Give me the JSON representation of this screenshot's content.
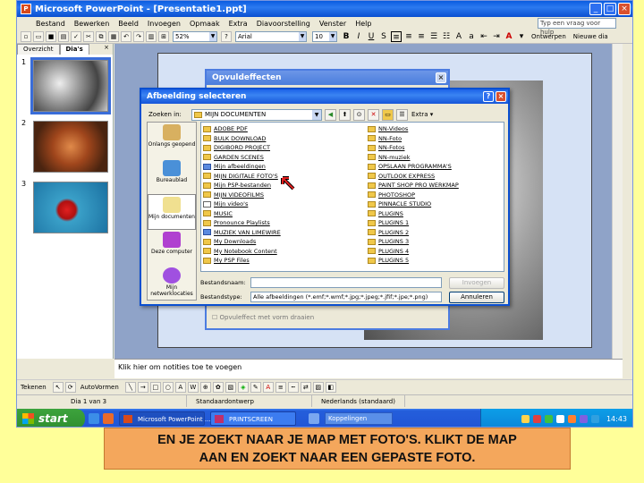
{
  "window": {
    "title": "Microsoft PowerPoint - [Presentatie1.ppt]",
    "help_box": "Typ een vraag voor hulp"
  },
  "menu": [
    "Bestand",
    "Bewerken",
    "Beeld",
    "Invoegen",
    "Opmaak",
    "Extra",
    "Diavoorstelling",
    "Venster",
    "Help"
  ],
  "toolbar": {
    "zoom": "52%",
    "font": "Arial",
    "size": "10",
    "bold": "B",
    "italic": "I",
    "underline": "U",
    "s_label": "S",
    "design_button": "Ontwerpen",
    "new_slide_button": "Nieuwe dia"
  },
  "slides_pane": {
    "tabs": [
      "Overzicht",
      "Dia's"
    ],
    "close": "×",
    "slides": [
      {
        "num": "1"
      },
      {
        "num": "2"
      },
      {
        "num": "3"
      }
    ]
  },
  "back_dialog": {
    "title": "Opvuldeffecten",
    "checkbox": "Opvuleffect met vorm draaien"
  },
  "dialog": {
    "title": "Afbeelding selecteren",
    "look_in_label": "Zoeken in:",
    "look_in_value": "MIJN DOCUMENTEN",
    "extra": "Extra",
    "places": [
      "Onlangs geopend",
      "Bureaublad",
      "Mijn documenten",
      "Deze computer",
      "Mijn netwerklocaties"
    ],
    "files_col1": [
      {
        "name": "ADOBE PDF",
        "icon": "folder"
      },
      {
        "name": "BULK DOWNLOAD",
        "icon": "folder"
      },
      {
        "name": "DIGIBORD PROJECT",
        "icon": "folder"
      },
      {
        "name": "GARDEN SCENES",
        "icon": "folder"
      },
      {
        "name": "Mijn afbeeldingen",
        "icon": "blue"
      },
      {
        "name": "MIJN DIGITALE FOTO'S",
        "icon": "folder"
      },
      {
        "name": "Mijn PSP-bestanden",
        "icon": "folder"
      },
      {
        "name": "MIJN VIDEOFILMS",
        "icon": "folder"
      },
      {
        "name": "Mijn video's",
        "icon": "white"
      },
      {
        "name": "MUSIC",
        "icon": "folder"
      },
      {
        "name": "Pronounce Playlists",
        "icon": "folder"
      },
      {
        "name": "MUZIEK VAN LIMEWIRE",
        "icon": "blue"
      },
      {
        "name": "My Downloads",
        "icon": "folder"
      },
      {
        "name": "My Notebook Content",
        "icon": "folder"
      },
      {
        "name": "My PSP Files",
        "icon": "folder"
      }
    ],
    "files_col2": [
      {
        "name": "NN-Videos",
        "icon": "folder"
      },
      {
        "name": "NN-Foto",
        "icon": "folder"
      },
      {
        "name": "NN-Fotos",
        "icon": "folder"
      },
      {
        "name": "NN-muziek",
        "icon": "folder"
      },
      {
        "name": "OPSLAAN PROGRAMMA'S",
        "icon": "folder"
      },
      {
        "name": "OUTLOOK EXPRESS",
        "icon": "folder"
      },
      {
        "name": "PAINT SHOP PRO WERKMAP",
        "icon": "folder"
      },
      {
        "name": "PHOTOSHOP",
        "icon": "folder"
      },
      {
        "name": "PINNACLE STUDIO",
        "icon": "folder"
      },
      {
        "name": "PLUGINS",
        "icon": "folder"
      },
      {
        "name": "PLUGINS 1",
        "icon": "folder"
      },
      {
        "name": "PLUGINS 2",
        "icon": "folder"
      },
      {
        "name": "PLUGINS 3",
        "icon": "folder"
      },
      {
        "name": "PLUGINS 4",
        "icon": "folder"
      },
      {
        "name": "PLUGINS 5",
        "icon": "folder"
      }
    ],
    "filename_label": "Bestandsnaam:",
    "filename_value": "",
    "filetype_label": "Bestandstype:",
    "filetype_value": "Alle afbeeldingen (*.emf;*.wmf;*.jpg;*.jpeg;*.jfif;*.jpe;*.png)",
    "insert_button": "Invoegen",
    "cancel_button": "Annuleren"
  },
  "notes": "Klik hier om notities toe te voegen",
  "drawbar": {
    "tekenen": "Tekenen",
    "autovormen": "AutoVormen"
  },
  "status": [
    "Dia 1 van 3",
    "Standaardontwerp",
    "Nederlands (standaard)"
  ],
  "taskbar": {
    "start": "start",
    "tasks": [
      "Microsoft PowerPoint ...",
      "PRINTSCREEN"
    ],
    "address": "Koppelingen",
    "clock": "14:43"
  },
  "caption": {
    "line1": "EN JE ZOEKT NAAR JE MAP MET FOTO'S. KLIKT DE MAP",
    "line2": "AAN EN ZOEKT NAAR EEN GEPASTE FOTO."
  }
}
